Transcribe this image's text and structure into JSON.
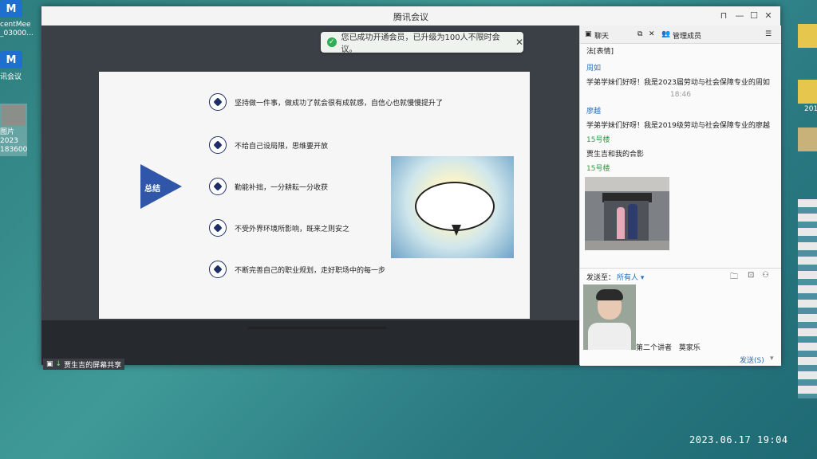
{
  "desktop": {
    "icon1_label_line1": "centMee",
    "icon1_label_line2": "_03000...",
    "icon2_label": "讯会议",
    "icon3_label_line1": "图片2023",
    "icon3_label_line2": "183600",
    "right_edge_label": "201",
    "photo_timestamp": "2023.06.17 19:04"
  },
  "window": {
    "title": "腾讯会议",
    "minimize": "—",
    "maximize": "☐",
    "close": "✕",
    "pin": "⊓"
  },
  "toast": {
    "text": "您已成功开通会员，已升级为100人不限时会议。",
    "close": "✕"
  },
  "slide": {
    "summary_label": "总结",
    "bullets": [
      "坚持做一件事，做成功了就会很有成就感，自信心也就慢慢提升了",
      "不给自己设局限，思维要开放",
      "勤能补拙，一分耕耘一分收获",
      "不受外界环境所影响，既来之则安之",
      "不断完善自己的职业规划，走好职场中的每一步"
    ]
  },
  "screen_share": {
    "label": "贾生吉的屏幕共享"
  },
  "chat": {
    "tab_chat": "聊天",
    "tab_members": "管理成员",
    "cut_message": "法[表情]",
    "messages": [
      {
        "sender": "周如",
        "text": "学弟学妹们好呀！我是2023届劳动与社会保障专业的周如"
      },
      {
        "sender": "廖越",
        "text": "学弟学妹们好呀！我是2019级劳动与社会保障专业的廖越"
      },
      {
        "sender": "15号楼",
        "text": "贾生吉和我的合影"
      },
      {
        "sender": "15号楼",
        "text": ""
      }
    ],
    "timestamp": "18:46",
    "send_to_label": "发送至：",
    "send_to_value": "所有人",
    "compose_text": "第二个讲者",
    "compose_name": "莫家乐",
    "send_button": "发送(S)"
  }
}
